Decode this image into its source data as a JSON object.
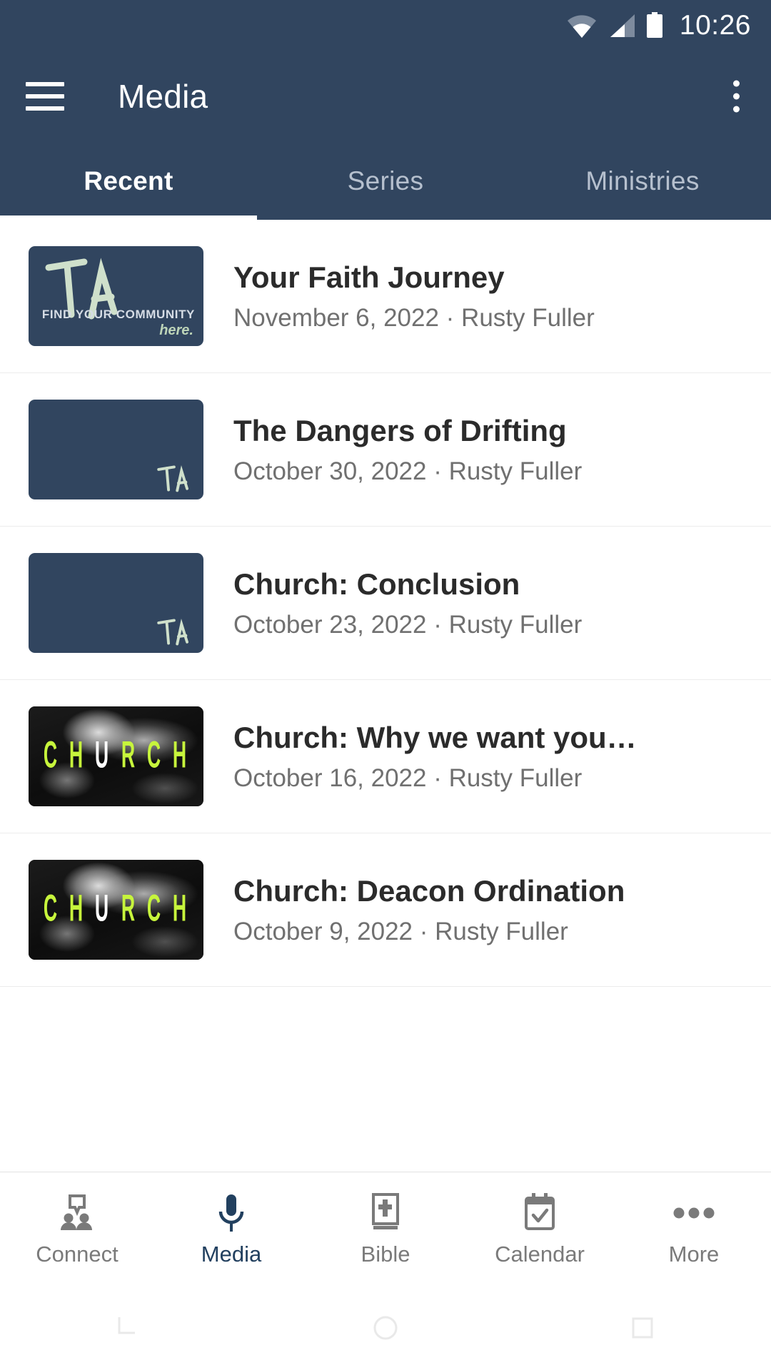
{
  "status_bar": {
    "wifi_icon": "wifi-icon",
    "signal_icon": "cell-signal-icon",
    "battery_icon": "battery-full-icon",
    "time": "10:26"
  },
  "app_bar": {
    "menu_icon": "hamburger-menu-icon",
    "title": "Media",
    "overflow_icon": "overflow-menu-icon"
  },
  "tabs": [
    {
      "label": "Recent",
      "active": true
    },
    {
      "label": "Series",
      "active": false
    },
    {
      "label": "Ministries",
      "active": false
    }
  ],
  "colors": {
    "header_blue": "#31455f",
    "accent_green": "#c7f53c",
    "active_nav": "#22405f",
    "secondary_text": "#707070"
  },
  "media_items": [
    {
      "title": "Your Faith Journey",
      "subtitle": "November 6, 2022 · Rusty Fuller",
      "date": "November 6, 2022",
      "speaker": "Rusty Fuller",
      "thumbnail": {
        "kind": "ta-logo-full",
        "logo_text": "TA",
        "tagline": "FIND YOUR COMMUNITY",
        "tagline_script": "here."
      }
    },
    {
      "title": "The Dangers of Drifting",
      "subtitle": "October 30, 2022 · Rusty Fuller",
      "date": "October 30, 2022",
      "speaker": "Rusty Fuller",
      "thumbnail": {
        "kind": "ta-logo-small",
        "logo_text": "TA"
      }
    },
    {
      "title": "Church: Conclusion",
      "subtitle": "October 23, 2022 · Rusty Fuller",
      "date": "October 23, 2022",
      "speaker": "Rusty Fuller",
      "thumbnail": {
        "kind": "ta-logo-small",
        "logo_text": "TA"
      }
    },
    {
      "title": "Church: Why we want you…",
      "subtitle": "October 16, 2022 · Rusty Fuller",
      "date": "October 16, 2022",
      "speaker": "Rusty Fuller",
      "thumbnail": {
        "kind": "church-art",
        "word": "CHURCH",
        "highlight_letter": "U"
      }
    },
    {
      "title": "Church: Deacon Ordination",
      "subtitle": "October 9, 2022 · Rusty Fuller",
      "date": "October 9, 2022",
      "speaker": "Rusty Fuller",
      "thumbnail": {
        "kind": "church-art",
        "word": "CHURCH",
        "highlight_letter": "U"
      }
    }
  ],
  "bottom_nav": [
    {
      "label": "Connect",
      "icon": "connect-people-icon",
      "active": false
    },
    {
      "label": "Media",
      "icon": "microphone-icon",
      "active": true
    },
    {
      "label": "Bible",
      "icon": "bible-book-icon",
      "active": false
    },
    {
      "label": "Calendar",
      "icon": "calendar-check-icon",
      "active": false
    },
    {
      "label": "More",
      "icon": "more-dots-icon",
      "active": false
    }
  ],
  "system_nav": {
    "back_icon": "android-back-icon",
    "home_icon": "android-home-icon",
    "recents_icon": "android-recents-icon"
  }
}
